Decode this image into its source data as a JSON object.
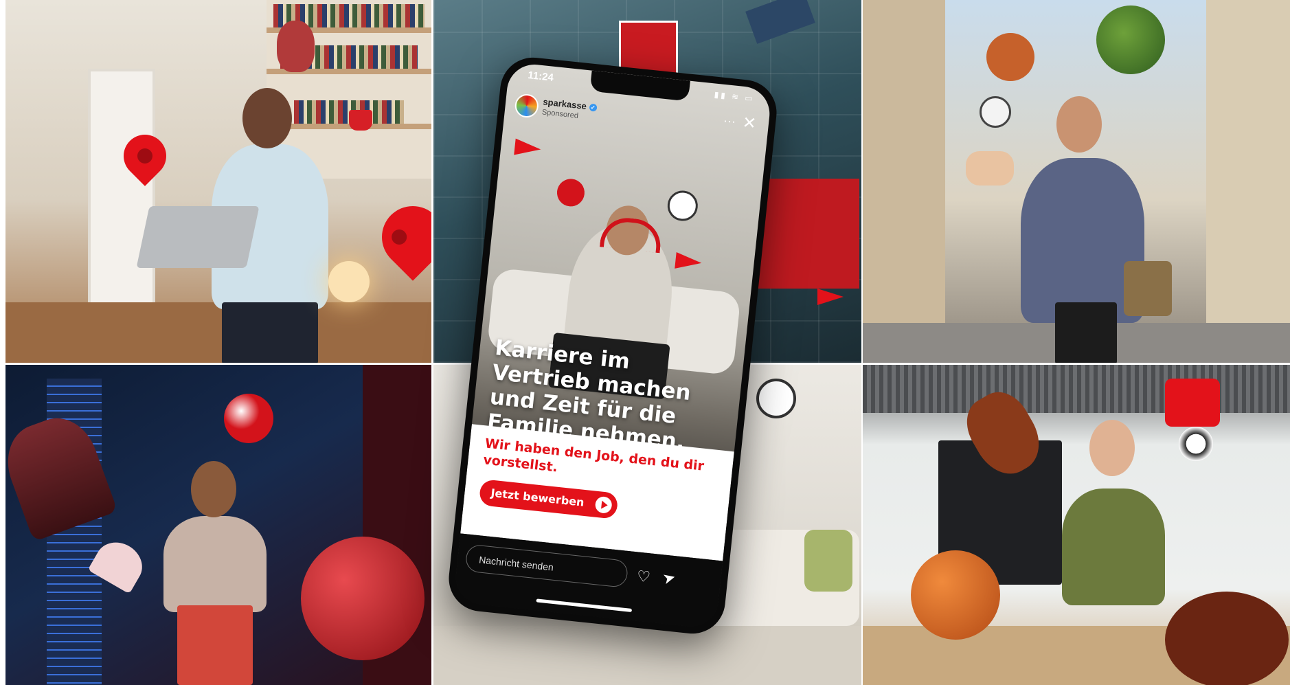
{
  "phone": {
    "status_time": "11:24",
    "status_icons": "▮▮ ≋ ▭",
    "account_name": "sparkasse",
    "verified_mark": "✓",
    "sponsored": "Sponsored",
    "more": "···",
    "close": "✕",
    "headline": "Karriere im Vertrieb machen und Zeit für die Familie nehmen.",
    "cta_text": "Wir haben den Job, den du dir vorstellst.",
    "cta_button": "Jetzt bewerben",
    "message_placeholder": "Nachricht senden",
    "heart": "♡",
    "send": "➤"
  },
  "colors": {
    "brand_red": "#e3121a",
    "phone_body": "#0a0a0a"
  },
  "icons": [
    "location-pin-icon",
    "play-icon",
    "heart-icon",
    "send-icon",
    "close-icon",
    "more-icon",
    "verified-icon"
  ]
}
